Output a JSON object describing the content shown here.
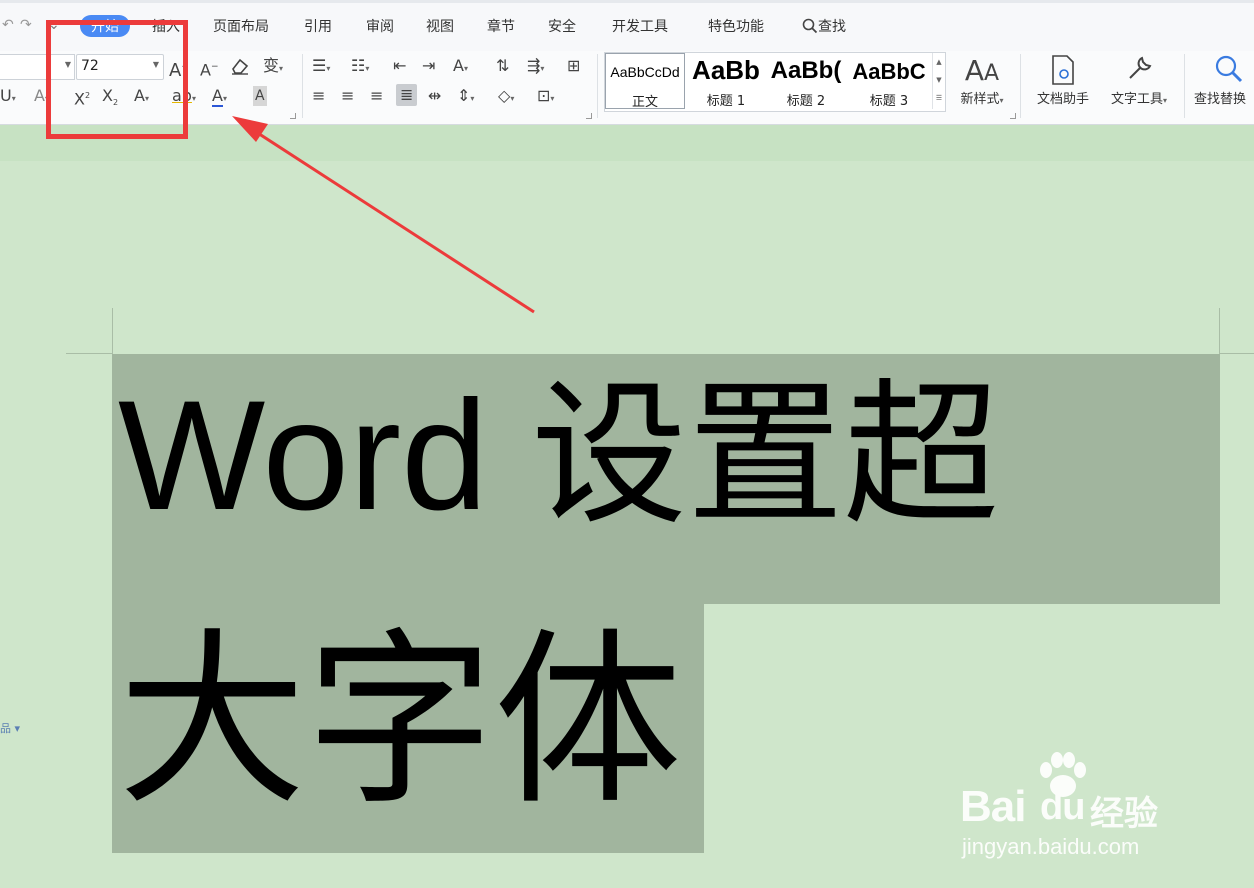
{
  "tabs": [
    {
      "label": "开始",
      "active": true
    },
    {
      "label": "插入",
      "active": false
    },
    {
      "label": "页面布局",
      "active": false
    },
    {
      "label": "引用",
      "active": false
    },
    {
      "label": "审阅",
      "active": false
    },
    {
      "label": "视图",
      "active": false
    },
    {
      "label": "章节",
      "active": false
    },
    {
      "label": "安全",
      "active": false
    },
    {
      "label": "开发工具",
      "active": false
    },
    {
      "label": "特色功能",
      "active": false
    }
  ],
  "search": {
    "label": "查找"
  },
  "font": {
    "size_value": "72"
  },
  "styles": [
    {
      "sample": "AaBbCcDd",
      "name": "正文"
    },
    {
      "sample": "AaBb",
      "name": "标题 1"
    },
    {
      "sample": "AaBb(",
      "name": "标题 2"
    },
    {
      "sample": "AaBbC",
      "name": "标题 3"
    }
  ],
  "buttons": {
    "new_style": "新样式",
    "doc_helper": "文档助手",
    "text_tools": "文字工具",
    "find_replace": "查找替换"
  },
  "document": {
    "line1": "Word 设置超",
    "line2": "大字体"
  },
  "watermark": {
    "brand": "Bai",
    "jingyan": "经验",
    "url": "jingyan.baidu.com"
  },
  "colors": {
    "accent": "#4a8af4",
    "highlight_box": "#ec3b3b",
    "arrow": "#ec3b3b",
    "page_background": "#cfe6cb",
    "selection": "#a1b59e",
    "font_color_underline": "#2b57d6"
  },
  "icons": [
    "undo-icon",
    "redo-icon",
    "increase-font-icon",
    "decrease-font-icon",
    "clear-format-icon",
    "phonetic-guide-icon",
    "underline-icon",
    "strikethrough-icon",
    "superscript-icon",
    "subscript-icon",
    "text-effect-icon",
    "highlight-icon",
    "font-color-icon",
    "char-shading-icon",
    "bullets-icon",
    "numbering-icon",
    "decrease-indent-icon",
    "increase-indent-icon",
    "text-direction-icon",
    "sort-icon",
    "line-spacing-icon",
    "table-icon",
    "align-left-icon",
    "align-center-icon",
    "align-right-icon",
    "justify-icon",
    "distribute-icon",
    "paragraph-spacing-icon",
    "shading-icon",
    "borders-icon",
    "new-style-icon",
    "doc-helper-icon",
    "text-tools-icon",
    "search-icon",
    "baidu-paw-icon"
  ]
}
